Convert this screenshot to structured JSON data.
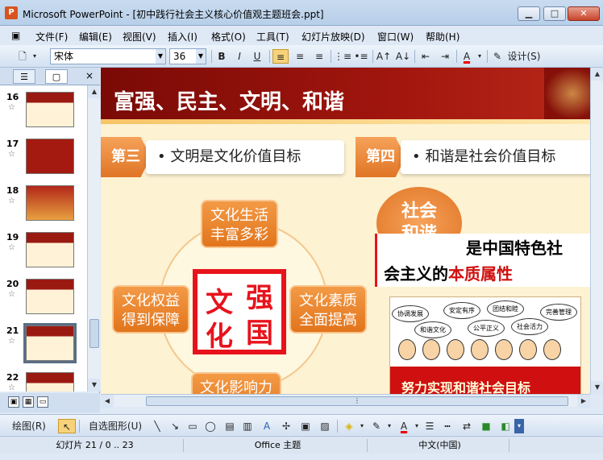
{
  "window": {
    "title": "Microsoft PowerPoint - [初中践行社会主义核心价值观主题班会.ppt]",
    "minimize": "▁",
    "maximize": "□",
    "close": "✕"
  },
  "menu": [
    "文件(F)",
    "编辑(E)",
    "视图(V)",
    "插入(I)",
    "格式(O)",
    "工具(T)",
    "幻灯片放映(D)",
    "窗口(W)",
    "帮助(H)"
  ],
  "toolbar": {
    "font_name": "宋体",
    "font_size": "36",
    "bold": "B",
    "italic": "I",
    "underline": "U",
    "font_color": "A",
    "design_label": "设计(S)"
  },
  "panel": {
    "tab_outline": "☰",
    "tab_slides": "▢",
    "close": "×",
    "slides": [
      {
        "num": "16",
        "star": "☆"
      },
      {
        "num": "17",
        "star": "☆"
      },
      {
        "num": "18",
        "star": "☆"
      },
      {
        "num": "19",
        "star": "☆"
      },
      {
        "num": "20",
        "star": "☆"
      },
      {
        "num": "21",
        "star": "☆"
      },
      {
        "num": "22",
        "star": "☆"
      }
    ]
  },
  "slide": {
    "title": "富强、民主、文明、和谐",
    "section3": {
      "tag": "第三",
      "text": "• 文明是文化价值目标"
    },
    "section4": {
      "tag": "第四",
      "text": "• 和谐是社会价值目标"
    },
    "box_top": "文化生活\n丰富多彩",
    "box_left": "文化权益\n得到保障",
    "box_right": "文化素质\n全面提高",
    "box_bottom": "文化影响力",
    "stamp": [
      "强",
      "国",
      "文",
      "化"
    ],
    "harmony_circle": "社会\n和谐",
    "harmony_line1": "是中国特色社",
    "harmony_line2a": "会主义的",
    "harmony_line2b": "本质属性",
    "bubbles": [
      "协调发展",
      "安定有序",
      "团结和睦",
      "完善管理",
      "和谐文化",
      "公平正义",
      "社会活力"
    ],
    "banner": "努力实现和谐社会目标"
  },
  "drawbar": {
    "draw": "绘图(R)",
    "autoshapes": "自选图形(U)"
  },
  "status": {
    "slide_info": "幻灯片 21 / 0 .. 23",
    "theme": "Office 主题",
    "language": "中文(中国)"
  },
  "colors": {
    "accent_orange": "#e07525",
    "header_red": "#a2160e",
    "stamp_red": "#e7131c"
  }
}
